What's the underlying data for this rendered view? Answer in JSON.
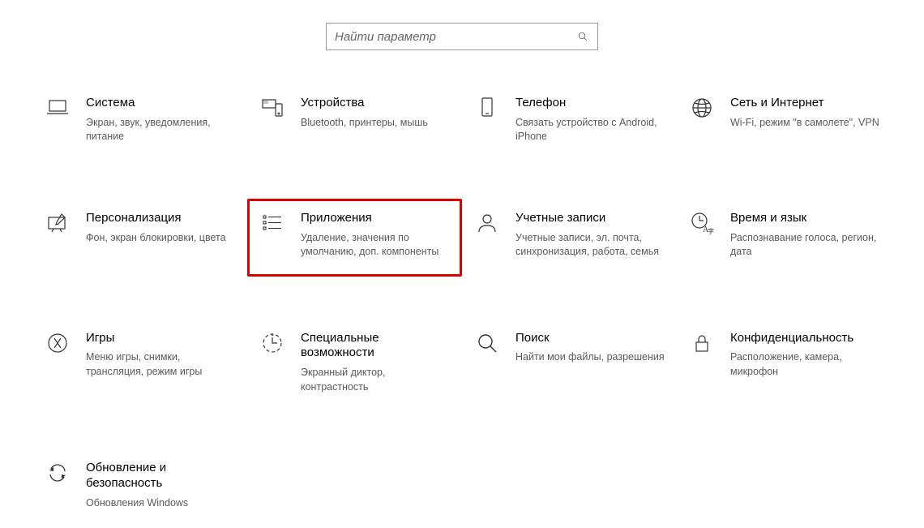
{
  "search": {
    "placeholder": "Найти параметр"
  },
  "tiles": [
    {
      "id": "system",
      "icon": "laptop-icon",
      "title": "Система",
      "desc": "Экран, звук, уведомления, питание"
    },
    {
      "id": "devices",
      "icon": "devices-icon",
      "title": "Устройства",
      "desc": "Bluetooth, принтеры, мышь"
    },
    {
      "id": "phone",
      "icon": "phone-icon",
      "title": "Телефон",
      "desc": "Связать устройство с Android, iPhone"
    },
    {
      "id": "network",
      "icon": "globe-icon",
      "title": "Сеть и Интернет",
      "desc": "Wi-Fi, режим \"в самолете\", VPN"
    },
    {
      "id": "personalization",
      "icon": "personal-icon",
      "title": "Персонализация",
      "desc": "Фон, экран блокировки, цвета"
    },
    {
      "id": "apps",
      "icon": "apps-icon",
      "title": "Приложения",
      "desc": "Удаление, значения по умолчанию, доп. компоненты",
      "highlight": true
    },
    {
      "id": "accounts",
      "icon": "person-icon",
      "title": "Учетные записи",
      "desc": "Учетные записи, эл. почта, синхронизация, работа, семья"
    },
    {
      "id": "time-lang",
      "icon": "time-lang-icon",
      "title": "Время и язык",
      "desc": "Распознавание голоса, регион, дата"
    },
    {
      "id": "gaming",
      "icon": "gaming-icon",
      "title": "Игры",
      "desc": "Меню игры, снимки, трансляция, режим игры"
    },
    {
      "id": "ease",
      "icon": "ease-icon",
      "title": "Специальные возможности",
      "desc": "Экранный диктор, контрастность"
    },
    {
      "id": "search-cat",
      "icon": "search-cat-icon",
      "title": "Поиск",
      "desc": "Найти мои файлы, разрешения"
    },
    {
      "id": "privacy",
      "icon": "lock-icon",
      "title": "Конфиденциальность",
      "desc": "Расположение, камера, микрофон"
    },
    {
      "id": "update",
      "icon": "update-icon",
      "title": "Обновление и безопасность",
      "desc": "Обновления Windows"
    }
  ]
}
